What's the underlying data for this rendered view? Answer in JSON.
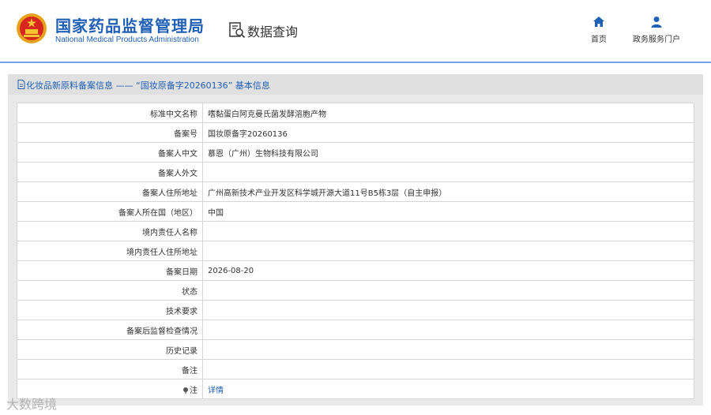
{
  "header": {
    "org_name_cn": "国家药品监督管理局",
    "org_name_en": "National Medical Products Administration",
    "section_title": "数据查询",
    "section_icon": "search-document-icon",
    "nav": [
      {
        "label": "首页",
        "icon": "home-icon"
      },
      {
        "label": "政务服务门户",
        "icon": "user-icon"
      }
    ]
  },
  "panel": {
    "title": "化妆品新原料备案信息 —— “国妆原备字20260136” 基本信息"
  },
  "records": [
    {
      "label": "标准中文名称",
      "value": "嗜黏蛋白阿克曼氏菌发酵溶胞产物"
    },
    {
      "label": "备案号",
      "value": "国妆原备字20260136"
    },
    {
      "label": "备案人中文",
      "value": "慕恩（广州）生物科技有限公司"
    },
    {
      "label": "备案人外文",
      "value": ""
    },
    {
      "label": "备案人住所地址",
      "value": "广州高新技术产业开发区科学城开源大道11号B5栋3层（自主申报）"
    },
    {
      "label": "备案人所在国（地区）",
      "value": "中国"
    },
    {
      "label": "境内责任人名称",
      "value": ""
    },
    {
      "label": "境内责任人住所地址",
      "value": ""
    },
    {
      "label": "备案日期",
      "value": "2026-08-20"
    },
    {
      "label": "状态",
      "value": ""
    },
    {
      "label": "技术要求",
      "value": ""
    },
    {
      "label": "备案后监督检查情况",
      "value": ""
    },
    {
      "label": "历史记录",
      "value": ""
    },
    {
      "label": "备注",
      "value": ""
    },
    {
      "label": "注",
      "value": "详情",
      "link": true,
      "icon": "pin-icon"
    }
  ],
  "watermark": "大数跨境",
  "colors": {
    "brand": "#1f5fb6",
    "header_rule": "#6fa4e6",
    "panel_bg": "#e9e9e9"
  }
}
